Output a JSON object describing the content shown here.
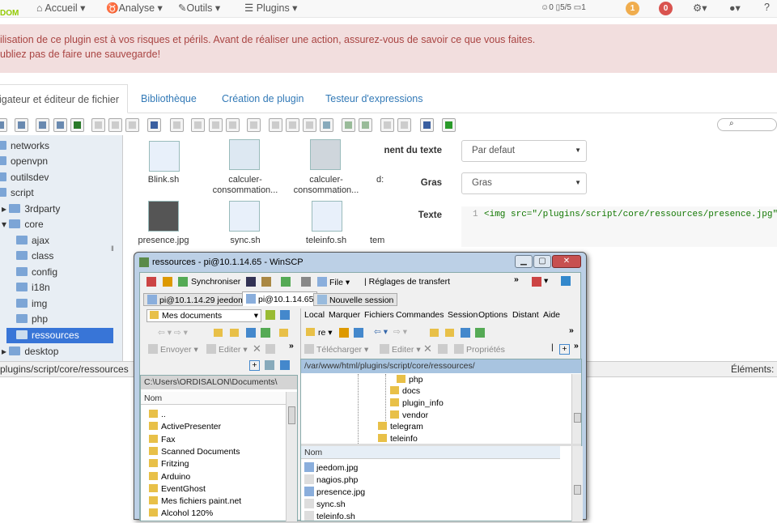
{
  "navbar": {
    "logo": "DOM",
    "items": [
      "Accueil",
      "Analyse",
      "Outils",
      "Plugins"
    ],
    "stats": {
      "person": "0",
      "doors": "5/5",
      "window": "1"
    },
    "badges": [
      {
        "value": "1",
        "color": "#f0ad4e"
      },
      {
        "value": "0",
        "color": "#d9534f"
      }
    ]
  },
  "alert": {
    "line1": "ilisation de ce plugin est à vos risques et périls. Avant de réaliser une action, assurez-vous de savoir ce que vous faites.",
    "line2": "ubliez pas de faire une sauvegarde!"
  },
  "tabs": [
    {
      "label": "igateur et éditeur de fichier",
      "active": true
    },
    {
      "label": "Bibliothèque"
    },
    {
      "label": "Création de plugin"
    },
    {
      "label": "Testeur d'expressions"
    }
  ],
  "tree": [
    {
      "label": "networks"
    },
    {
      "label": "openvpn"
    },
    {
      "label": "outilsdev"
    },
    {
      "label": "script"
    },
    {
      "label": "3rdparty"
    },
    {
      "label": "core"
    },
    {
      "label": "ajax"
    },
    {
      "label": "class"
    },
    {
      "label": "config"
    },
    {
      "label": "i18n"
    },
    {
      "label": "img"
    },
    {
      "label": "php"
    },
    {
      "label": "ressources",
      "selected": true
    },
    {
      "label": "desktop"
    }
  ],
  "files": [
    {
      "name": "Blink.sh",
      "type": "txt"
    },
    {
      "name": "calculer-consommation...",
      "type": "img"
    },
    {
      "name": "calculer-consommation...",
      "type": "img"
    },
    {
      "name": "d:",
      "type": ""
    },
    {
      "name": "presence.jpg",
      "type": "img"
    },
    {
      "name": "sync.sh",
      "type": "txt"
    },
    {
      "name": "teleinfo.sh",
      "type": "sh"
    },
    {
      "name": "tem",
      "type": ""
    }
  ],
  "editor": {
    "align_label": "nent du texte",
    "align_value": "Par defaut",
    "bold_label": "Gras",
    "bold_value": "Gras",
    "text_label": "Texte",
    "line_number": "1",
    "code": "<img src=\"/plugins/script/core/ressources/presence.jpg\">"
  },
  "statusbar": {
    "path": "plugins/script/core/ressources",
    "elements": "Éléments:"
  },
  "winscp": {
    "title": "ressources - pi@10.1.14.65 - WinSCP",
    "toolbar": {
      "sync": "Synchroniser",
      "file": "File",
      "transfer": "Réglages de transfert"
    },
    "sessions": [
      "pi@10.1.14.29 jeedom",
      "pi@10.1.14.65",
      "Nouvelle session"
    ],
    "left": {
      "location": "Mes documents",
      "send": "Envoyer",
      "edit": "Editer",
      "path": "C:\\Users\\ORDISALON\\Documents\\",
      "col": "Nom",
      "rows": [
        "..",
        "ActivePresenter",
        "Fax",
        "Scanned Documents",
        "Fritzing",
        "Arduino",
        "EventGhost",
        "Mes fichiers paint.net",
        "Alcohol 120%"
      ]
    },
    "right": {
      "menu": [
        "Local",
        "Marquer",
        "Fichiers",
        "Commandes",
        "Session",
        "Options",
        "Distant",
        "Aide"
      ],
      "location": "re",
      "download": "Télécharger",
      "edit": "Editer",
      "props": "Propriétés",
      "path": "/var/www/html/plugins/script/core/ressources/",
      "tree": [
        "php",
        "docs",
        "plugin_info",
        "vendor",
        "telegram",
        "teleinfo"
      ],
      "col": "Nom",
      "rows": [
        "jeedom.jpg",
        "nagios.php",
        "presence.jpg",
        "sync.sh",
        "teleinfo.sh"
      ]
    }
  }
}
